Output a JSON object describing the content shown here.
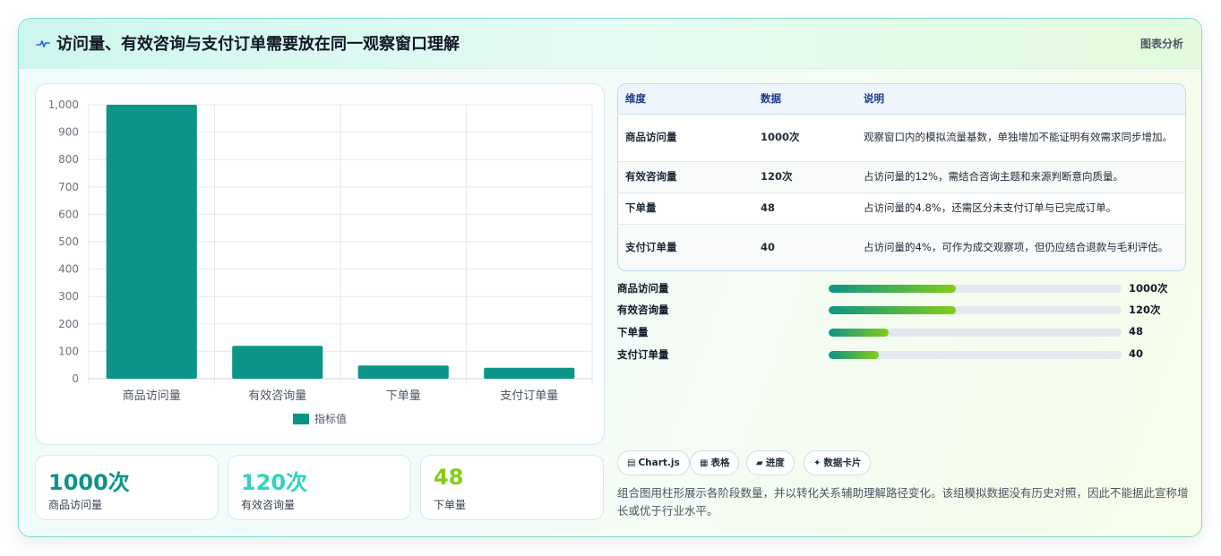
{
  "header": {
    "title": "访问量、有效咨询与支付订单需要放在同一观察窗口理解",
    "tag": "图表分析"
  },
  "chart_data": {
    "type": "bar",
    "categories": [
      "商品访问量",
      "有效咨询量",
      "下单量",
      "支付订单量"
    ],
    "series": [
      {
        "name": "指标值",
        "values": [
          1000,
          120,
          48,
          40
        ]
      }
    ],
    "ylim": [
      0,
      1000
    ],
    "yticks": [
      "0",
      "100",
      "200",
      "300",
      "400",
      "500",
      "600",
      "700",
      "800",
      "900",
      "1,000"
    ],
    "legend": "bottom",
    "grid": true,
    "colors": {
      "bar": "#0d9488"
    }
  },
  "stats": [
    {
      "value": "1000次",
      "label": "商品访问量",
      "color": "#0d9488"
    },
    {
      "value": "120次",
      "label": "有效咨询量",
      "color": "#2dd4bf"
    },
    {
      "value": "48",
      "label": "下单量",
      "color": "#84cc16"
    }
  ],
  "table": {
    "headers": [
      "维度",
      "数据",
      "说明"
    ],
    "rows": [
      {
        "dim": "商品访问量",
        "val": "1000次",
        "desc": "观察窗口内的模拟流量基数，单独增加不能证明有效需求同步增加。"
      },
      {
        "dim": "有效咨询量",
        "val": "120次",
        "desc": "占访问量的12%，需结合咨询主题和来源判断意向质量。"
      },
      {
        "dim": "下单量",
        "val": "48",
        "desc": "占访问量的4.8%，还需区分未支付订单与已完成订单。"
      },
      {
        "dim": "支付订单量",
        "val": "40",
        "desc": "占访问量的4%，可作为成交观察项，但仍应结合退款与毛利评估。"
      }
    ]
  },
  "progress": [
    {
      "label": "商品访问量",
      "value": "1000次",
      "fraction": 0.435
    },
    {
      "label": "有效咨询量",
      "value": "120次",
      "fraction": 0.435
    },
    {
      "label": "下单量",
      "value": "48",
      "fraction": 0.205
    },
    {
      "label": "支付订单量",
      "value": "40",
      "fraction": 0.17
    }
  ],
  "chips": [
    {
      "icon": "▤",
      "label": "Chart.js"
    },
    {
      "icon": "▦",
      "label": "表格"
    },
    {
      "icon": "▰",
      "label": "进度"
    },
    {
      "icon": "✦",
      "label": "数据卡片"
    }
  ],
  "note": "组合图用柱形展示各阶段数量，并以转化关系辅助理解路径变化。该组模拟数据没有历史对照，因此不能据此宣称增长或优于行业水平。"
}
